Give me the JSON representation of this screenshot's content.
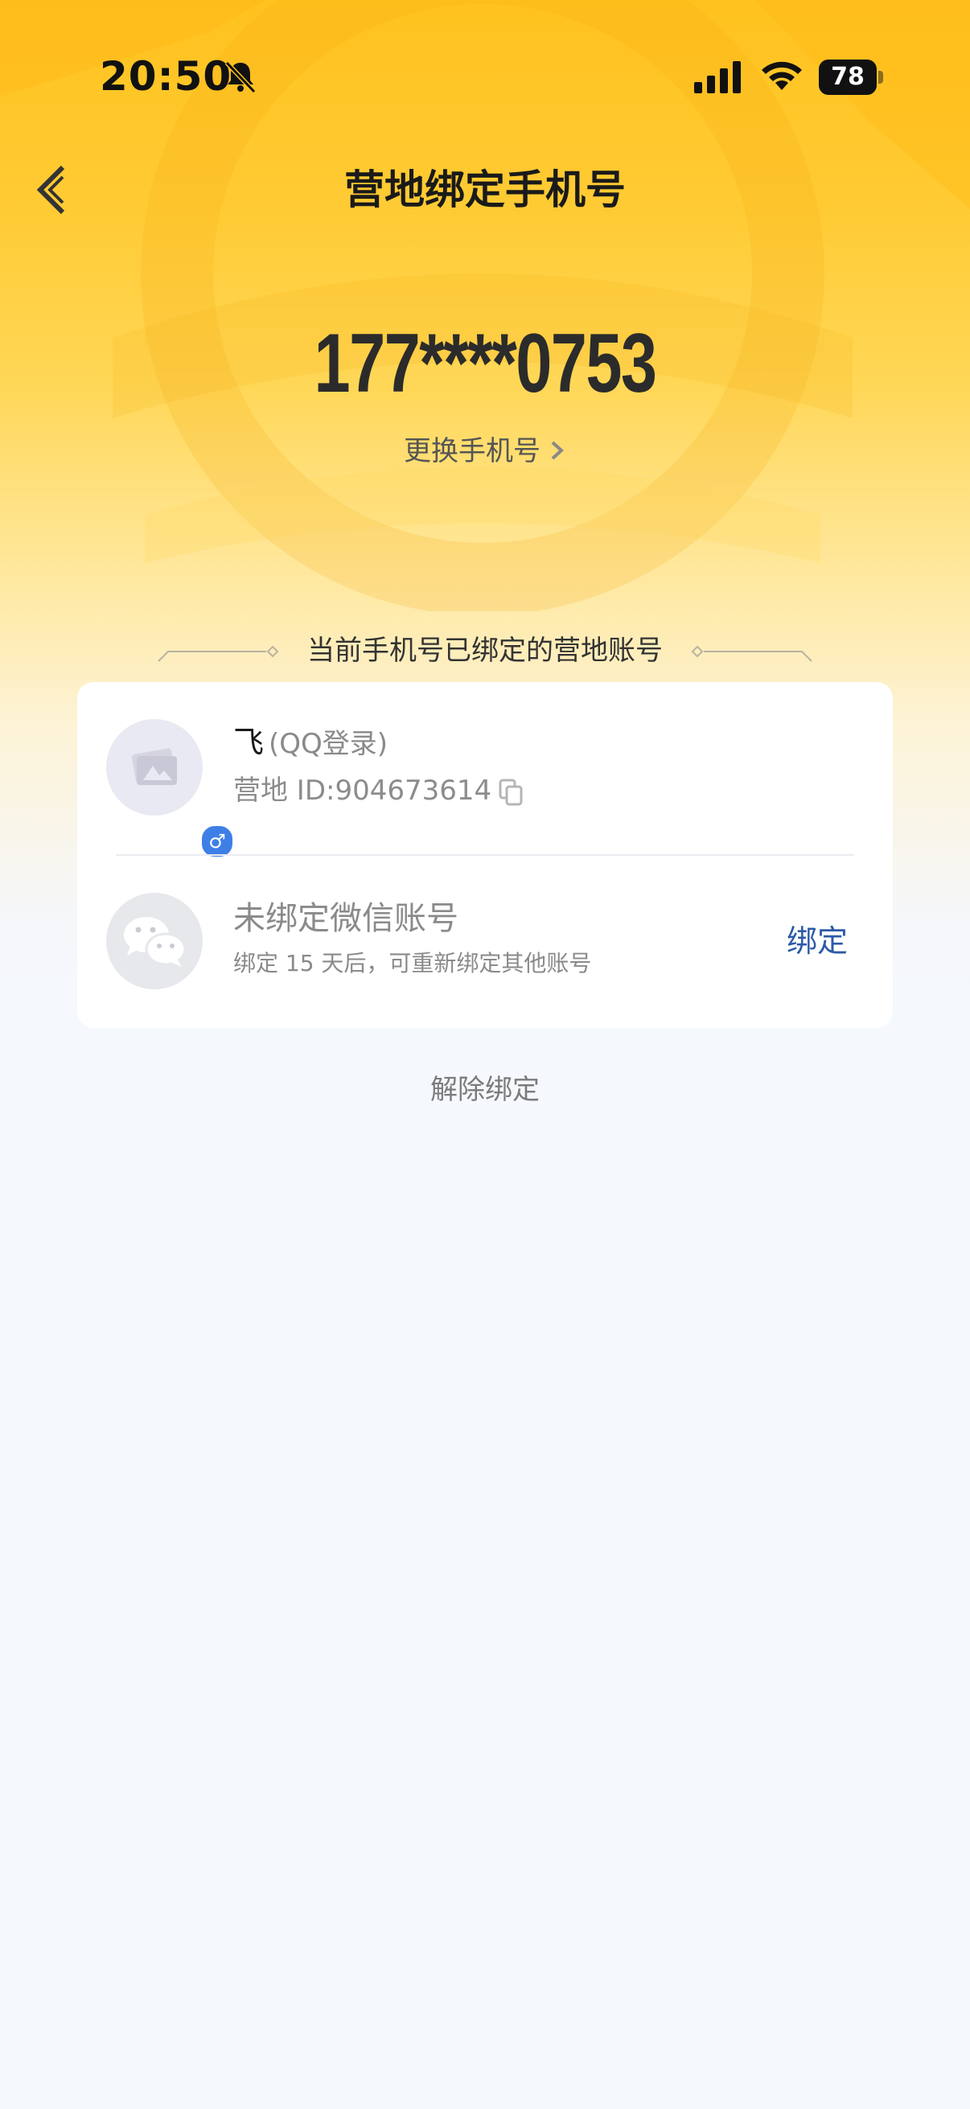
{
  "status_bar": {
    "time": "20:50",
    "battery": "78",
    "icons": [
      "bell-muted-icon",
      "signal-icon",
      "wifi-icon",
      "battery-icon"
    ]
  },
  "nav": {
    "title": "营地绑定手机号",
    "back_icon": "chevron-left-icon"
  },
  "phone": {
    "number": "177****0753",
    "change_label": "更换手机号"
  },
  "section": {
    "title": "当前手机号已绑定的营地账号"
  },
  "account": {
    "name": "飞",
    "login_type": "(QQ登录)",
    "id_text": "营地 ID:904673614",
    "gender": "♂"
  },
  "wechat": {
    "title": "未绑定微信账号",
    "note": "绑定 15 天后，可重新绑定其他账号",
    "bind_label": "绑定"
  },
  "footer": {
    "unbind_label": "解除绑定"
  },
  "colors": {
    "header_gradient_top": "#ffc21e",
    "page_background": "#f5f8fd",
    "bind_link": "#2c5aa8",
    "gender_badge": "#3e7fe6"
  }
}
